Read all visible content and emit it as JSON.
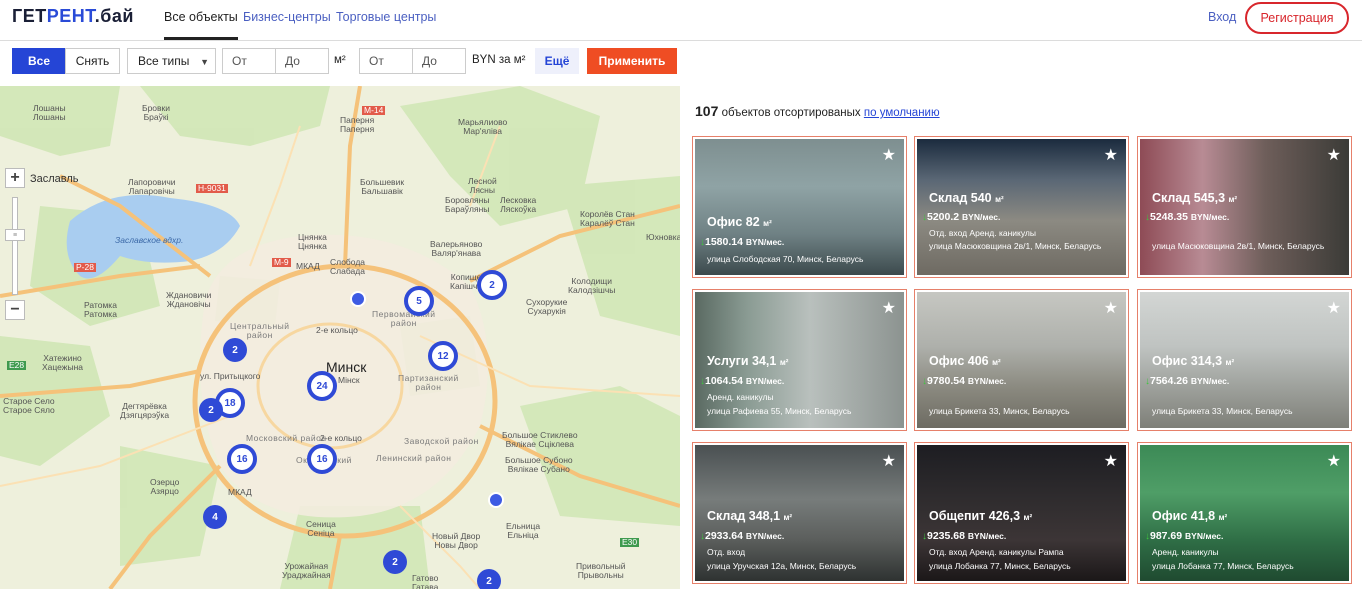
{
  "header": {
    "logo_prefix": "ГЕТ",
    "logo_accent": "РЕНТ",
    "logo_suffix": ".бай",
    "tabs": [
      {
        "label": "Все объекты",
        "active": true
      },
      {
        "label": "Бизнес-центры",
        "active": false
      },
      {
        "label": "Торговые центры",
        "active": false
      }
    ],
    "login": "Вход",
    "register": "Регистрация"
  },
  "filters": {
    "all": "Все",
    "clear": "Снять",
    "type_select": "Все типы",
    "area_from": "От",
    "area_to": "До",
    "area_unit": "м²",
    "price_from": "От",
    "price_to": "До",
    "price_unit": "BYN за м²",
    "more": "Ещё",
    "apply": "Применить"
  },
  "map": {
    "labels": {
      "zaslavl": "Заслаўе",
      "zaslavl2": "Заславль",
      "reservoir": "Заславское вдхр.",
      "minsk": "Минск",
      "minsk_by": "Мінск",
      "loshany": "Лошаны\nЛошаны",
      "brovki": "Бровки\nБраўкі",
      "papernia": "Папернянь\nПапернянь",
      "paperniа2": "Паперня\nПаперня",
      "lesnoy": "Лесной\nЛясны",
      "malinovka": "Марьялиово\nМар'ялiва",
      "borovlyany": "Боровляны\nБараўляны",
      "leskovka": "Лесковка\nЛяскоўка",
      "korolev": "Королёв Стан\nКаралёў Стан",
      "yukhnovka": "Юхновка",
      "kolodishchi": "Колодищи\nКалодзiшчы",
      "sukharevo": "Сухорукие\nСухарукiя",
      "lapirovichi": "Лапоровичи\nЛапаровiчы",
      "zhdanovichi": "Ждановичи\nЖдановiчы",
      "ratomka": "Ратомка\nРатомка",
      "tsnyanka": "Цнянка\nЦнянка",
      "sloboda": "Слобода\nСлабада",
      "valeryanovo": "Валерьяново\nВаляр'янава",
      "khatezhino": "Хатежино\nХацежына",
      "staroeselo": "Старое Село\nСтарое Сяло",
      "degtyarevka": "Дегтярёвка\nДзягцярэўка",
      "ozertso": "Озерцо\nАзярцо",
      "senitsa": "Сеница\nСеніца",
      "urozhaynaya": "Урожайная\nУраджайная",
      "gatovo": "Гатово\nГатава",
      "novydvor": "Новый Двор\nНовы Двор",
      "yeltsy": "Ельница\nЕльніца",
      "privolny": "Привольный\nПрывольны",
      "bolshoe_stiklevo": "Большое Стиклево\nВялікае Сціклева",
      "bolshoe_sustino": "Большое Субоно\nВялікае Субано",
      "kopishche": "Копище\nКапiшча",
      "bolshevik": "Большевик\nБальшавiк",
      "mkad": "МКАД",
      "kolco2": "2-е кольцо",
      "pritytskogo": "ул. Притыцкого",
      "d_central": "Центральный\nрайон",
      "d_pervomay": "Первомайский\nрайон",
      "d_partizan": "Партизанский\nрайон",
      "d_zavod": "Заводской район",
      "d_lenin": "Ленинский район",
      "d_moskov": "Московский район",
      "d_oktyabr": "Октябрьский",
      "m14": "М-14",
      "m9": "М-9",
      "h9031": "Н-9031",
      "p28": "Р-28",
      "e28": "E28",
      "e30": "E30"
    },
    "clusters": [
      "2",
      "5",
      "12",
      "2",
      "18",
      "2",
      "24",
      "16",
      "16",
      "4",
      "2",
      "2"
    ]
  },
  "results": {
    "count": "107",
    "text": "объектов отсортированых",
    "sort_link": "по умолчанию"
  },
  "cards": [
    {
      "title": "Офис 82",
      "unit": "м²",
      "price": "1580.14",
      "currency": "BYN/мес.",
      "tags": "",
      "address": "улица Слободская 70, Минск, Беларусь"
    },
    {
      "title": "Склад 540",
      "unit": "м²",
      "price": "5200.2",
      "currency": "BYN/мес.",
      "tags": "Отд. вход   Аренд. каникулы",
      "address": "улица Масюковщина 2в/1, Минск, Беларусь"
    },
    {
      "title": "Склад 545,3",
      "unit": "м²",
      "price": "5248.35",
      "currency": "BYN/мес.",
      "tags": "",
      "address": "улица Масюковщина 2в/1, Минск, Беларусь"
    },
    {
      "title": "Услуги 34,1",
      "unit": "м²",
      "price": "1064.54",
      "currency": "BYN/мес.",
      "tags": "Аренд. каникулы",
      "address": "улица Рафиева 55, Минск, Беларусь"
    },
    {
      "title": "Офис 406",
      "unit": "м²",
      "price": "9780.54",
      "currency": "BYN/мес.",
      "tags": "",
      "address": "улица Брикета 33, Минск, Беларусь"
    },
    {
      "title": "Офис 314,3",
      "unit": "м²",
      "price": "7564.26",
      "currency": "BYN/мес.",
      "tags": "",
      "address": "улица Брикета 33, Минск, Беларусь"
    },
    {
      "title": "Склад 348,1",
      "unit": "м²",
      "price": "2933.64",
      "currency": "BYN/мес.",
      "tags": "Отд. вход",
      "address": "улица Уручская 12а, Минск, Беларусь"
    },
    {
      "title": "Общепит 426,3",
      "unit": "м²",
      "price": "9235.68",
      "currency": "BYN/мес.",
      "tags": "Отд. вход   Аренд. каникулы   Рампа",
      "address": "улица Лобанка 77, Минск, Беларусь"
    },
    {
      "title": "Офис 41,8",
      "unit": "м²",
      "price": "987.69",
      "currency": "BYN/мес.",
      "tags": "Аренд. каникулы",
      "address": "улица Лобанка 77, Минск, Беларусь"
    }
  ]
}
